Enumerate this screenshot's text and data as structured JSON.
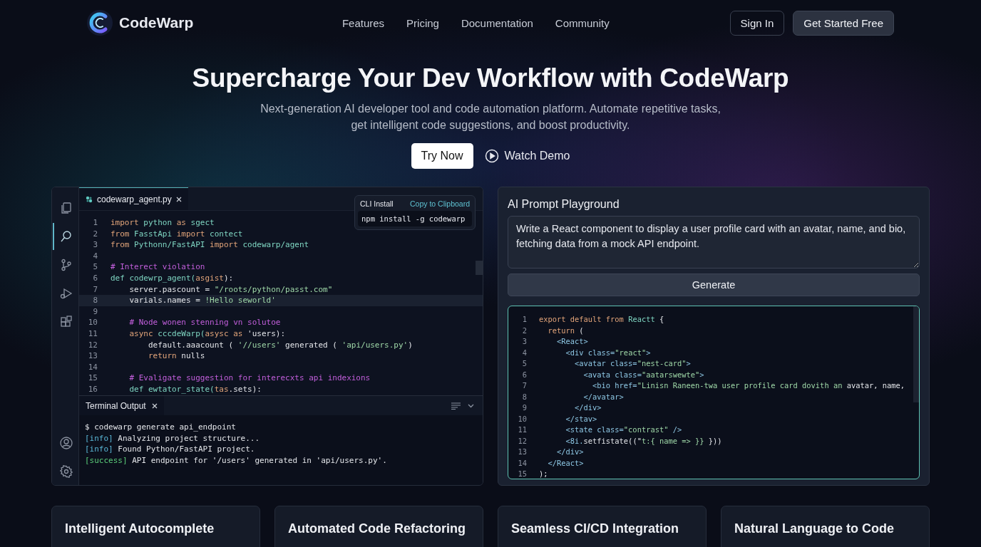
{
  "nav": {
    "brand": "CodeWarp",
    "links": [
      {
        "label": "Features"
      },
      {
        "label": "Pricing"
      },
      {
        "label": "Documentation"
      },
      {
        "label": "Community"
      }
    ],
    "sign_in": "Sign In",
    "cta": "Get Started Free"
  },
  "hero": {
    "title": "Supercharge Your Dev Workflow with CodeWarp",
    "subtitle": "Next-generation AI developer tool and code automation platform. Automate repetitive tasks, get intelligent code suggestions, and boost productivity.",
    "primary": "Try Now",
    "secondary": "Watch Demo"
  },
  "editor": {
    "activity": [
      {
        "selected": false
      },
      {
        "selected": true
      },
      {
        "selected": false
      },
      {
        "selected": false
      },
      {
        "selected": false
      }
    ],
    "tab": "codewarp_agent.py",
    "cli": {
      "label": "CLI Install",
      "action": "Copy to Clipboard",
      "command": "npm install -g codewarp"
    },
    "lines": [
      {
        "num": "1",
        "current": false,
        "tokens": [
          {
            "kind": "kw",
            "text": "import"
          },
          {
            "kind": "id",
            "text": " python "
          },
          {
            "kind": "kw",
            "text": "as"
          },
          {
            "kind": "id",
            "text": " sgect"
          }
        ]
      },
      {
        "num": "2",
        "current": false,
        "tokens": [
          {
            "kind": "kw",
            "text": "from"
          },
          {
            "kind": "id",
            "text": " FasstApi "
          },
          {
            "kind": "kw",
            "text": "import"
          },
          {
            "kind": "id",
            "text": " contect"
          }
        ]
      },
      {
        "num": "3",
        "current": false,
        "tokens": [
          {
            "kind": "kw",
            "text": "from"
          },
          {
            "kind": "id",
            "text": " Pythonn/FastAPI "
          },
          {
            "kind": "kw",
            "text": "import"
          },
          {
            "kind": "id",
            "text": " codewarp/agent"
          }
        ]
      },
      {
        "num": "4",
        "current": false
      },
      {
        "num": "5",
        "current": false,
        "tokens": [
          {
            "kind": "comment",
            "text": "# Interect violation"
          }
        ]
      },
      {
        "num": "6",
        "current": false,
        "tokens": [
          {
            "kind": "id",
            "text": "def codewrp_agent("
          },
          {
            "kind": "kw",
            "text": "asgist"
          },
          {
            "kind": "plain",
            "text": "):"
          }
        ]
      },
      {
        "num": "7",
        "current": false,
        "tokens": [
          {
            "kind": "plain",
            "text": "    server.pascount = "
          },
          {
            "kind": "str",
            "text": "\"/roots/python/passt.com\""
          }
        ]
      },
      {
        "num": "8",
        "current": true,
        "tokens": [
          {
            "kind": "plain",
            "text": "    varials.names = "
          },
          {
            "kind": "str",
            "text": "!Hello seworld'"
          }
        ]
      },
      {
        "num": "9",
        "current": false
      },
      {
        "num": "10",
        "current": false,
        "tokens": [
          {
            "kind": "comment",
            "text": "    # Node wonen stenning vn solutoe"
          }
        ]
      },
      {
        "num": "11",
        "current": false,
        "tokens": [
          {
            "kind": "kw",
            "text": "    async "
          },
          {
            "kind": "id",
            "text": "cccdeWarp("
          },
          {
            "kind": "kw",
            "text": "asysc as "
          },
          {
            "kind": "plain",
            "text": "'users):"
          }
        ]
      },
      {
        "num": "12",
        "current": false,
        "tokens": [
          {
            "kind": "plain",
            "text": "        default.aaacount ( "
          },
          {
            "kind": "str",
            "text": "'//users'"
          },
          {
            "kind": "plain",
            "text": " generated ( "
          },
          {
            "kind": "str",
            "text": "'api/users.py'"
          },
          {
            "kind": "plain",
            "text": ")"
          }
        ]
      },
      {
        "num": "13",
        "current": false,
        "tokens": [
          {
            "kind": "kw",
            "text": "        return "
          },
          {
            "kind": "plain",
            "text": "nulls"
          }
        ]
      },
      {
        "num": "14",
        "current": false
      },
      {
        "num": "15",
        "current": false,
        "tokens": [
          {
            "kind": "comment",
            "text": "    # Evaligate suggestion for interecxts api indexions"
          }
        ]
      },
      {
        "num": "16",
        "current": false,
        "tokens": [
          {
            "kind": "id",
            "text": "    def ewtator_state("
          },
          {
            "kind": "kw",
            "text": "tas"
          },
          {
            "kind": "plain",
            "text": ".sets):"
          }
        ]
      }
    ],
    "terminal": {
      "tab": "Terminal Output",
      "lines": [
        {
          "tokens": [
            {
              "kind": "plain",
              "text": "$ codewarp generate api_endpoint"
            }
          ]
        },
        {
          "tokens": [
            {
              "kind": "info",
              "text": "[info]"
            },
            {
              "kind": "plain",
              "text": " Analyzing project structure..."
            }
          ]
        },
        {
          "tokens": [
            {
              "kind": "info",
              "text": "[info]"
            },
            {
              "kind": "plain",
              "text": " Found Python/FastAPI project."
            }
          ]
        },
        {
          "tokens": [
            {
              "kind": "success",
              "text": "[success]"
            },
            {
              "kind": "plain",
              "text": " API endpoint for '/users' generated in 'api/users.py'."
            }
          ]
        }
      ]
    }
  },
  "playground": {
    "title": "AI Prompt Playground",
    "prompt": "Write a React component to display a user profile card with an avatar, name, and bio, fetching data from a mock API endpoint.",
    "button": "Generate",
    "lines": [
      {
        "num": "1",
        "tokens": [
          {
            "kind": "kw",
            "text": "export default from "
          },
          {
            "kind": "id",
            "text": "Reactt"
          },
          {
            "kind": "plain",
            "text": " {"
          }
        ]
      },
      {
        "num": "2",
        "tokens": [
          {
            "kind": "kw",
            "text": "  return "
          },
          {
            "kind": "plain",
            "text": "("
          }
        ]
      },
      {
        "num": "3",
        "tokens": [
          {
            "kind": "tag",
            "text": "    <React>"
          }
        ]
      },
      {
        "num": "4",
        "tokens": [
          {
            "kind": "tag",
            "text": "      <div class="
          },
          {
            "kind": "str",
            "text": "\"react\""
          },
          {
            "kind": "tag",
            "text": ">"
          }
        ]
      },
      {
        "num": "5",
        "tokens": [
          {
            "kind": "tag",
            "text": "        <avatar class="
          },
          {
            "kind": "str",
            "text": "\"nest-card\""
          },
          {
            "kind": "tag",
            "text": ">"
          }
        ]
      },
      {
        "num": "6",
        "tokens": [
          {
            "kind": "tag",
            "text": "          <avata class="
          },
          {
            "kind": "str",
            "text": "\"aatarswewte\""
          },
          {
            "kind": "tag",
            "text": ">"
          }
        ]
      },
      {
        "num": "7",
        "tokens": [
          {
            "kind": "tag",
            "text": "            <bio href="
          },
          {
            "kind": "str",
            "text": "\"Linisn Raneen-twa user profile card dovith an"
          },
          {
            "kind": "plain",
            "text": " avatar, name,"
          }
        ]
      },
      {
        "num": "8",
        "tokens": [
          {
            "kind": "tag",
            "text": "          </avatar>"
          }
        ]
      },
      {
        "num": "9",
        "tokens": [
          {
            "kind": "tag",
            "text": "        </div>"
          }
        ]
      },
      {
        "num": "10",
        "tokens": [
          {
            "kind": "tag",
            "text": "      </stav>"
          }
        ]
      },
      {
        "num": "11",
        "tokens": [
          {
            "kind": "tag",
            "text": "      <state class="
          },
          {
            "kind": "str",
            "text": "\"contrast\""
          },
          {
            "kind": "tag",
            "text": " />"
          }
        ]
      },
      {
        "num": "12",
        "tokens": [
          {
            "kind": "tag",
            "text": "      <8i."
          },
          {
            "kind": "plain",
            "text": "setfistate((\""
          },
          {
            "kind": "str",
            "text": "t:{ name => }}"
          },
          {
            "kind": "plain",
            "text": " }))"
          }
        ]
      },
      {
        "num": "13",
        "tokens": [
          {
            "kind": "tag",
            "text": "    </div>"
          }
        ]
      },
      {
        "num": "14",
        "tokens": [
          {
            "kind": "tag",
            "text": "  </React>"
          }
        ]
      },
      {
        "num": "15",
        "tokens": [
          {
            "kind": "plain",
            "text": ");"
          }
        ]
      }
    ]
  },
  "features": [
    {
      "title": "Intelligent Autocomplete"
    },
    {
      "title": "Automated Code Refactoring"
    },
    {
      "title": "Seamless CI/CD Integration"
    },
    {
      "title": "Natural Language to Code"
    }
  ]
}
